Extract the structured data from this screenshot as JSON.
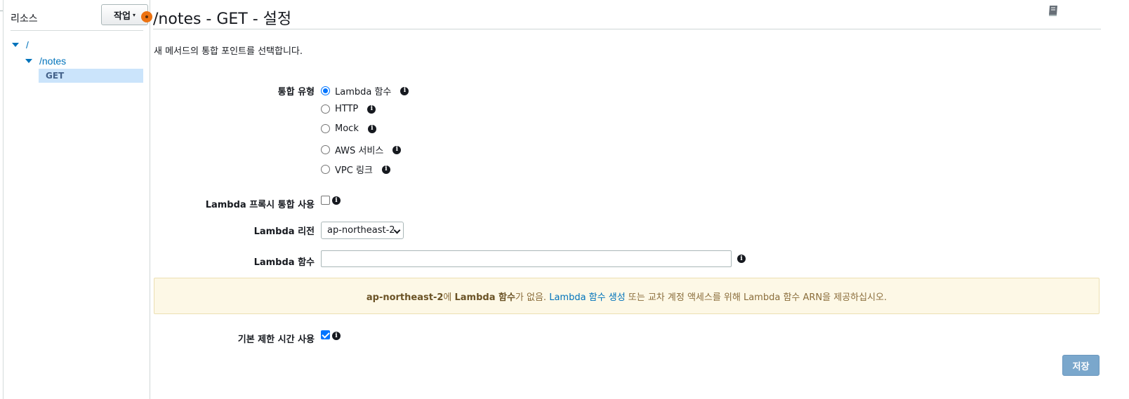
{
  "sidebar": {
    "title": "리소스",
    "action_button": {
      "label": "작업",
      "caret": "▾"
    },
    "tree": [
      {
        "label": "/",
        "level": 0,
        "expanded": true
      },
      {
        "label": "/notes",
        "level": 1,
        "expanded": true
      },
      {
        "label": "GET",
        "level": 2,
        "selected": true
      }
    ]
  },
  "main": {
    "title": "/notes - GET - 설정",
    "subtitle": "새 메서드의 통합 포인트를 선택합니다.",
    "integration_type": {
      "label": "통합 유형",
      "options": [
        {
          "label": "Lambda 함수",
          "checked": true
        },
        {
          "label": "HTTP",
          "checked": false
        },
        {
          "label": "Mock",
          "checked": false
        },
        {
          "label": "AWS 서비스",
          "checked": false
        },
        {
          "label": "VPC 링크",
          "checked": false
        }
      ]
    },
    "proxy": {
      "label": "Lambda 프록시 통합 사용",
      "checked": false
    },
    "region": {
      "label": "Lambda 리전",
      "value": "ap-northeast-2"
    },
    "function": {
      "label": "Lambda 함수",
      "value": "",
      "placeholder": ""
    },
    "alert": {
      "region": "ap-northeast-2",
      "text1": "에 ",
      "bold": "Lambda 함수",
      "text2": "가 없음. ",
      "link": "Lambda 함수 생성",
      "text3": " 또는 교차 계정 액세스를 위해 Lambda 함수 ARN을 제공하십시오."
    },
    "default_timeout": {
      "label": "기본 제한 시간 사용",
      "checked": true
    },
    "save_label": "저장",
    "info_glyph": "i"
  },
  "colors": {
    "link": "#0073bb",
    "accent_orange": "#ec7211",
    "selected_bg": "#cbe4fb",
    "alert_bg": "#fdf8e6",
    "save_button": "#7aa7cc"
  },
  "icons": [
    "book-icon",
    "info-icon",
    "caret-down-icon",
    "collapse-handle-icon",
    "chevron-down-icon"
  ]
}
